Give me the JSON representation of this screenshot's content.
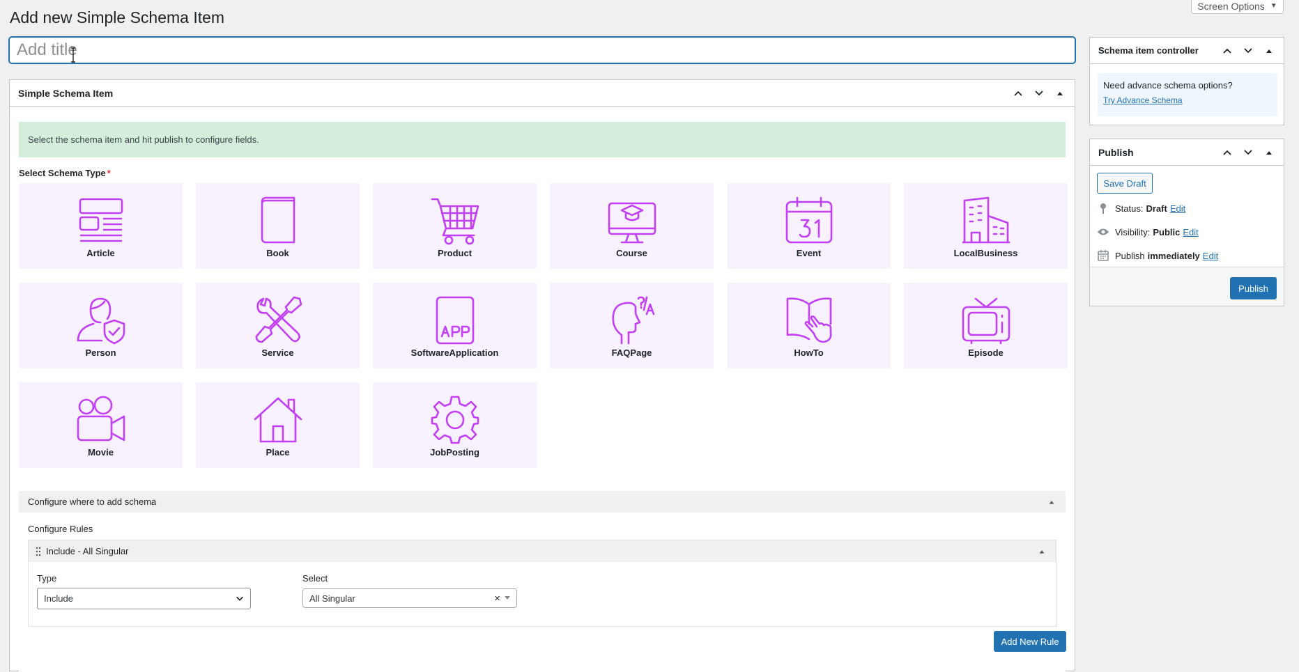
{
  "page": {
    "title": "Add new Simple Schema Item",
    "screen_options": "Screen Options",
    "title_placeholder": "Add title"
  },
  "main_box": {
    "title": "Simple Schema Item",
    "notice": "Select the schema item and hit publish to configure fields.",
    "select_label": "Select Schema Type",
    "required_mark": "*",
    "tiles": [
      {
        "label": "Article",
        "icon": "article-icon"
      },
      {
        "label": "Book",
        "icon": "book-icon"
      },
      {
        "label": "Product",
        "icon": "cart-icon"
      },
      {
        "label": "Course",
        "icon": "monitor-mortarboard-icon"
      },
      {
        "label": "Event",
        "icon": "calendar-icon"
      },
      {
        "label": "LocalBusiness",
        "icon": "buildings-icon"
      },
      {
        "label": "Person",
        "icon": "person-shield-icon"
      },
      {
        "label": "Service",
        "icon": "tools-icon"
      },
      {
        "label": "SoftwareApplication",
        "icon": "app-icon"
      },
      {
        "label": "FAQPage",
        "icon": "head-qa-icon"
      },
      {
        "label": "HowTo",
        "icon": "book-hand-icon"
      },
      {
        "label": "Episode",
        "icon": "tv-icon"
      },
      {
        "label": "Movie",
        "icon": "video-camera-icon"
      },
      {
        "label": "Place",
        "icon": "house-icon"
      },
      {
        "label": "JobPosting",
        "icon": "gear-icon"
      }
    ],
    "icon_color": "#c23ff5",
    "tile_bg": "#f8f1fe"
  },
  "configure": {
    "heading": "Configure where to add schema",
    "rules_label": "Configure Rules",
    "rule": {
      "title": "Include - All Singular",
      "type_label": "Type",
      "type_value": "Include",
      "select_label": "Select",
      "select_value": "All Singular",
      "clear": "×"
    },
    "add_rule": "Add New Rule"
  },
  "controller": {
    "title": "Schema item controller",
    "promo_text": "Need advance schema options?",
    "promo_link": "Try Advance Schema"
  },
  "publish": {
    "title": "Publish",
    "save_draft": "Save Draft",
    "status_label": "Status:",
    "status_value": "Draft",
    "visibility_label": "Visibility:",
    "visibility_value": "Public",
    "publish_label": "Publish",
    "publish_value": "immediately",
    "edit": "Edit",
    "publish_button": "Publish"
  },
  "colors": {
    "primary": "#2271b1",
    "notice_bg": "#d3eeda"
  }
}
